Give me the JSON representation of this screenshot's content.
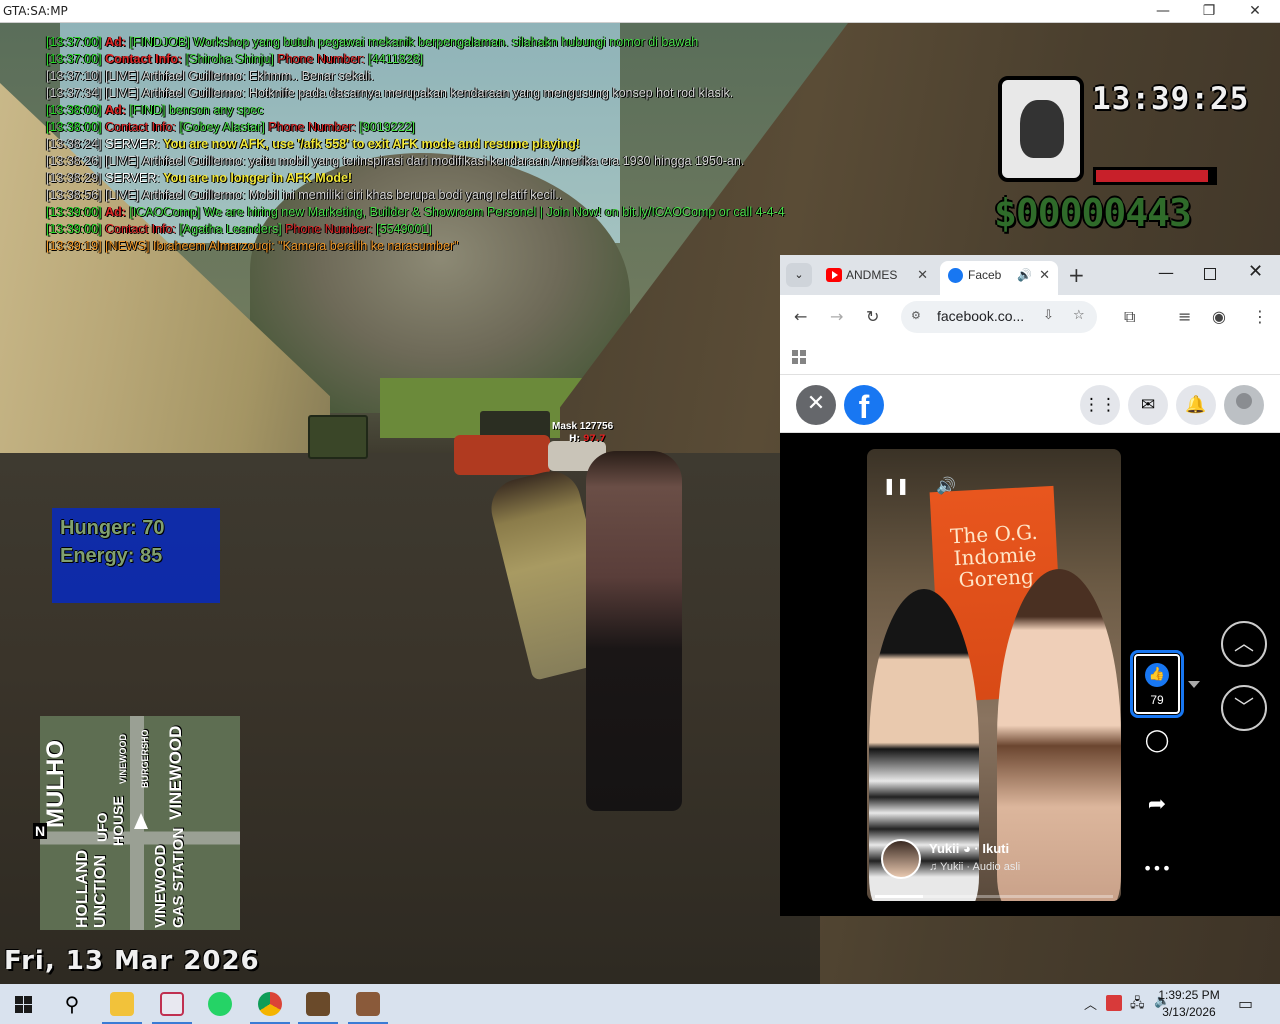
{
  "window": {
    "title": "GTA:SA:MP",
    "minimize": "—",
    "restore": "❐",
    "close": "✕"
  },
  "chat": [
    [
      {
        "t": "[13:37:00] ",
        "c": "c-time"
      },
      {
        "t": "Ad: ",
        "c": "c-ad"
      },
      {
        "t": "[FINDJOB] Workshop yang butuh pegawai mekanik berpengalaman. silahakn hubungi nomor di bawah",
        "c": "c-adtxt"
      }
    ],
    [
      {
        "t": "[13:37:00] ",
        "c": "c-time"
      },
      {
        "t": "Contact Info: ",
        "c": "c-ad"
      },
      {
        "t": "[",
        "c": "c-adtxt"
      },
      {
        "t": "Shiroha Shinju",
        "c": "c-adtxt"
      },
      {
        "t": "] ",
        "c": "c-adtxt"
      },
      {
        "t": "Phone Number: ",
        "c": "c-red"
      },
      {
        "t": "[",
        "c": "c-adtxt"
      },
      {
        "t": "4411828",
        "c": "c-adtxt"
      },
      {
        "t": "]",
        "c": "c-adtxt"
      }
    ],
    [
      {
        "t": "[13:37:10] ",
        "c": "c-time-g"
      },
      {
        "t": "[LIVE] Arthfael Guillermo: Ekhmm.. Benar sekali.",
        "c": "c-gray"
      }
    ],
    [
      {
        "t": "[13:37:34] ",
        "c": "c-time-g"
      },
      {
        "t": "[LIVE] Arthfael Guillermo: Hotknife pada dasarnya merupakan kendaraan yang mengusung konsep hot rod klasik.",
        "c": "c-gray"
      }
    ],
    [
      {
        "t": "[13:38:00] ",
        "c": "c-time"
      },
      {
        "t": "Ad: ",
        "c": "c-ad"
      },
      {
        "t": "[FIND] benson any spec",
        "c": "c-adtxt"
      }
    ],
    [
      {
        "t": "[13:38:00] ",
        "c": "c-time"
      },
      {
        "t": "Contact Info: ",
        "c": "c-red"
      },
      {
        "t": "[Gobey Alastar] ",
        "c": "c-adtxt"
      },
      {
        "t": "Phone Number: ",
        "c": "c-red"
      },
      {
        "t": "[9019222]",
        "c": "c-adtxt"
      }
    ],
    [
      {
        "t": "[13:38:24] ",
        "c": "c-time-g"
      },
      {
        "t": "SERVER: ",
        "c": "c-white"
      },
      {
        "t": "You are now AFK, use '/afk 558' to exit AFK mode and resume playing!",
        "c": "c-yellow"
      }
    ],
    [
      {
        "t": "[13:38:26] ",
        "c": "c-time-g"
      },
      {
        "t": "[LIVE] Arthfael Guillermo: yaitu mobil yang terinspirasi dari modifikasi kendaraan Amerika era 1930 hingga 1950-an.",
        "c": "c-gray"
      }
    ],
    [
      {
        "t": "[13:38:29] ",
        "c": "c-time-g"
      },
      {
        "t": "SERVER: ",
        "c": "c-white"
      },
      {
        "t": "You are no longer in AFK Mode!",
        "c": "c-yellow"
      }
    ],
    [
      {
        "t": "[13:38:56] ",
        "c": "c-time-g"
      },
      {
        "t": "[LIVE] Arthfael Guillermo: Mobil ini memiliki ciri khas berupa bodi yang relatif kecil..",
        "c": "c-gray"
      }
    ],
    [
      {
        "t": "[13:39:00] ",
        "c": "c-time"
      },
      {
        "t": "Ad: ",
        "c": "c-ad"
      },
      {
        "t": "[ICAOComp] We are hiring new Marketing, Builder & Showroom Personel | Join Now! on bit.ly/ICAOComp or call 4-4-4",
        "c": "c-adtxt"
      }
    ],
    [
      {
        "t": "[13:39:00] ",
        "c": "c-time"
      },
      {
        "t": "Contact Info: ",
        "c": "c-red"
      },
      {
        "t": "[Agatha Leanders] ",
        "c": "c-adtxt"
      },
      {
        "t": "Phone Number: ",
        "c": "c-red"
      },
      {
        "t": "[5549001]",
        "c": "c-adtxt"
      }
    ],
    [
      {
        "t": "[13:39:19] ",
        "c": "c-orange"
      },
      {
        "t": "[NEWS] Ibraheem Almarzouqi: \"Kamera beralih ke narasumber\"",
        "c": "c-orange"
      }
    ]
  ],
  "hud": {
    "clock": "13:39:25",
    "money": "$00000443",
    "health_fraction": 0.95,
    "icon": "fist-weapon-icon"
  },
  "player_tag": {
    "name": "Mask 127756",
    "hp_label": "H:",
    "hp_value": "97.7"
  },
  "stats": {
    "hunger_label": "Hunger:",
    "hunger": "70",
    "energy_label": "Energy:",
    "energy": "85"
  },
  "radar": {
    "north": "N",
    "labels": [
      "MULHO",
      "UFO",
      "HOUSE",
      "VINEWOOD",
      "BURGERSHO",
      "VINEWOOD",
      "HOLLAND",
      "UNCTION",
      "VINEWOOD",
      "GAS STATION"
    ]
  },
  "date": "Fri, 13 Mar 2026",
  "browser": {
    "tabs": [
      {
        "label": "ANDMES",
        "close": "✕"
      },
      {
        "label": "Faceb",
        "close": "✕"
      }
    ],
    "tab_dropdown": "⌄",
    "new_tab": "+",
    "url": "facebook.co...",
    "fb": {
      "close": "✕",
      "logo": "f",
      "menu_icon": "⋮⋮",
      "messenger_icon": "✉",
      "bell_icon": "🔔"
    },
    "video": {
      "banner_text": "The O.G. Indomie Goreng",
      "author": "Yukii ◕ · Ikuti",
      "audio": "♫ Yukii · Audio asli",
      "progress": 0.2,
      "pause": "❚❚",
      "volume": "🔊"
    },
    "reactions": {
      "like_count": "79",
      "comment": "◯",
      "share": "➦",
      "more": "•••"
    },
    "nav": {
      "up": "︿",
      "down": "﹀"
    }
  },
  "taskbar": {
    "clock_time": "1:39:25 PM",
    "clock_date": "3/13/2026",
    "search": "⚲",
    "tray_chevron": "︿",
    "notify": "▭"
  }
}
